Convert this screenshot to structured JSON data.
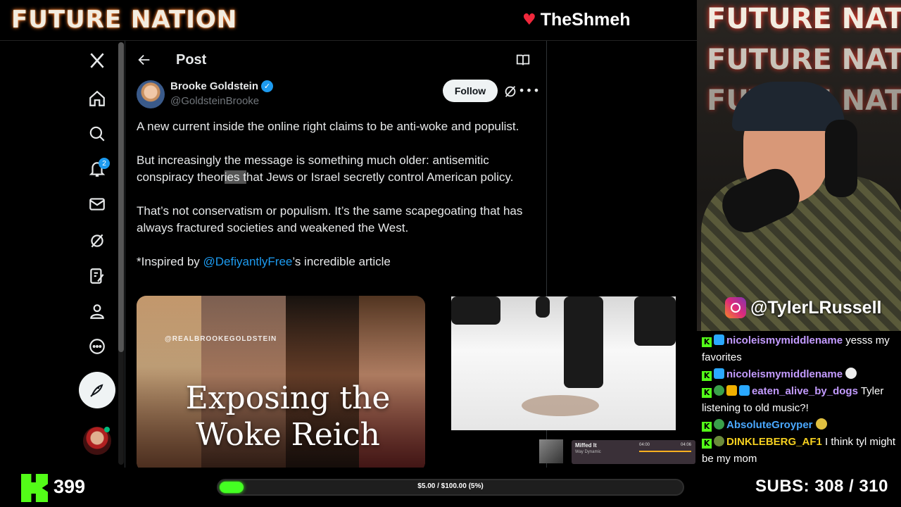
{
  "stream": {
    "title": "FUTURE NATION",
    "brand": "TheShmeh",
    "instagram": "@TylerLRussell",
    "cam_sign": "FUTURE NATION",
    "follower_count": "399",
    "goal_text": "$5.00 / $100.00 (5%)",
    "goal_progress": 0.05,
    "subs_label": "SUBS:",
    "subs_value": "308 / 310",
    "accent_green": "#53fc18"
  },
  "nav": {
    "items": [
      "x-logo-icon",
      "home-icon",
      "explore-icon",
      "notifications-icon",
      "messages-icon",
      "grok-icon",
      "lists-icon",
      "profile-icon",
      "more-icon"
    ],
    "notification_count": "2"
  },
  "post": {
    "header_title": "Post",
    "author_name": "Brooke Goldstein",
    "author_handle": "@GoldsteinBrooke",
    "follow_label": "Follow",
    "para1": "A new current inside the online right claims to be anti-woke and populist.",
    "para2_start": "But increasingly the message is something much older: antisemitic conspiracy theor",
    "para2_highlight": "ies t",
    "para2_end": "hat Jews or Israel secretly control American policy.",
    "para3": "That’s not conservatism or populism. It’s the same scapegoating that has always fractured societies and weakened the West.",
    "para4_start": "*Inspired by ",
    "para4_mention": "@DefiyantlyFree",
    "para4_end": "’s incredible article",
    "card_watermark": "@REALBROOKEGOLDSTEIN",
    "card_headline": "Exposing the Woke Reich"
  },
  "chat": [
    {
      "user": "nicoleismymiddlename",
      "color": "#c39bff",
      "text": "yesss my favorites"
    },
    {
      "user": "nicoleismymiddlename",
      "color": "#c39bff",
      "text": ""
    },
    {
      "user": "eaten_alive_by_dogs",
      "color": "#c39bff",
      "text": "Tyler listening to old music?!"
    },
    {
      "user": "AbsoluteGroyper",
      "color": "#4aa8ff",
      "text": ""
    },
    {
      "user": "DINKLEBERG_AF1",
      "color": "#f5d020",
      "text": "I think tyl might be my mom"
    }
  ],
  "mini_player": {
    "track": "Miffed It",
    "artist": "Way Dynamic",
    "time_elapsed": "04:00",
    "time_total": "04:06"
  }
}
